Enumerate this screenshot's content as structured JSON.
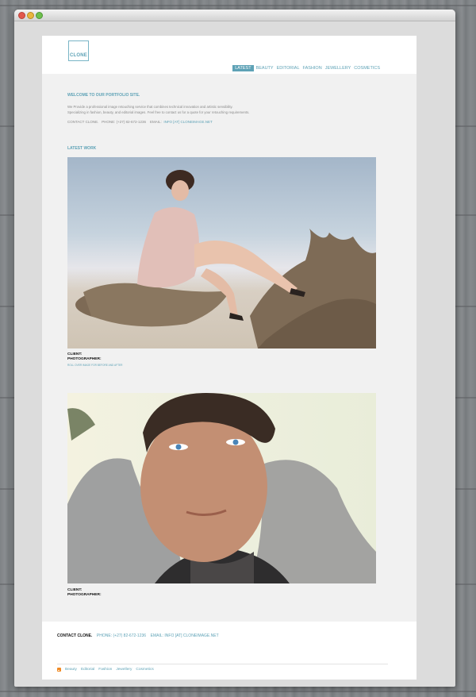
{
  "site": {
    "logo_text": "CLONE",
    "accent_color": "#5ea2b6"
  },
  "nav": {
    "items": [
      {
        "label": "LATEST",
        "active": true
      },
      {
        "label": "BEAUTY",
        "active": false
      },
      {
        "label": "EDITORIAL",
        "active": false
      },
      {
        "label": "FASHION",
        "active": false
      },
      {
        "label": "JEWELLERY",
        "active": false
      },
      {
        "label": "COSMETICS",
        "active": false
      }
    ]
  },
  "intro": {
    "heading": "WELCOME TO OUR PORTFOLIO SITE.",
    "line1": "We Provide a professional image retouching service that combines technical innovation and artistic sensibility.",
    "line2": "Specializing in fashion, beauty, and editorial images. Feel free to contact us for a quote for your retouching requirements.",
    "contact_label": "CONTACT CLONE.",
    "phone": "PHONE: (+27) 82-672-1236",
    "email_label": "EMAIL:",
    "email": "INFO [AT] CLONEIMAGE.NET"
  },
  "latest": {
    "heading": "LATEST WORK",
    "items": [
      {
        "client_label": "CLIENT:",
        "photographer_label": "PHOTOGRAPHER:",
        "link": "ROLL OVER IMAGE FOR BEFORE AND AFTER"
      },
      {
        "client_label": "CLIENT:",
        "photographer_label": "PHOTOGRAPHER:"
      }
    ]
  },
  "footer": {
    "contact_label": "CONTACT CLONE.",
    "phone": "PHONE: (+27) 82-672-1236",
    "email": "EMAIL: INFO [AT] CLONEIMAGE.NET",
    "links": [
      "Beauty",
      "Editorial",
      "Fashion",
      "Jewellery",
      "Cosmetics"
    ],
    "rss_icon": "rss-icon"
  }
}
